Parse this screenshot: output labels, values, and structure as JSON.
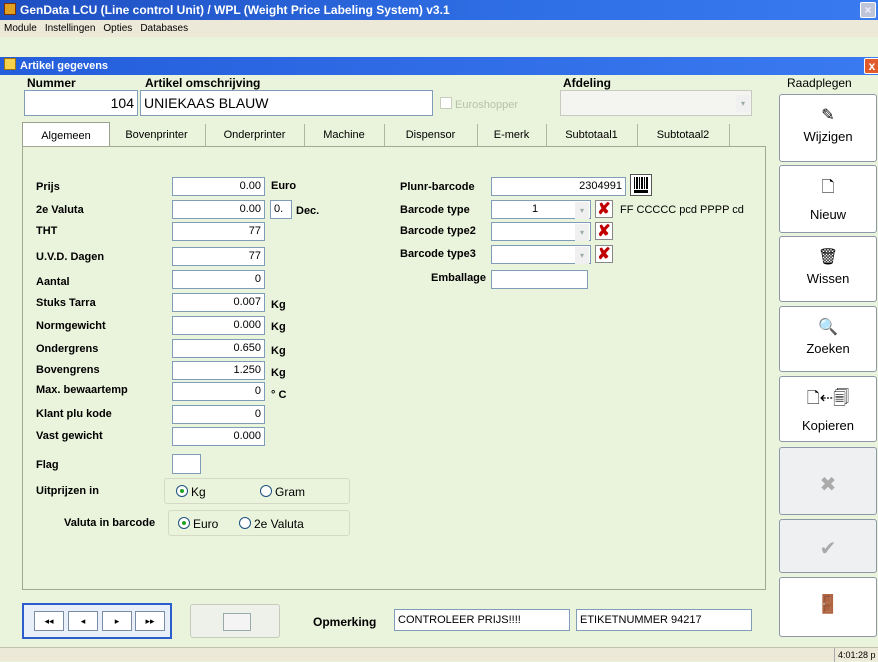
{
  "window": {
    "title": "GenData LCU (Line control Unit) / WPL (Weight Price Labeling System)  v3.1"
  },
  "menu": [
    "Module",
    "Instellingen",
    "Opties",
    "Databases"
  ],
  "subwindow": {
    "title": "Artikel gegevens",
    "close": "x"
  },
  "header": {
    "nummer_label": "Nummer",
    "nummer_value": "104",
    "omschrijving_label": "Artikel omschrijving",
    "omschrijving_value": "UNIEKAAS BLAUW",
    "euroshopper_label": "Euroshopper",
    "afdeling_label": "Afdeling",
    "afdeling_value": ""
  },
  "tabs": [
    "Algemeen",
    "Bovenprinter",
    "Onderprinter",
    "Machine",
    "Dispensor",
    "E-merk",
    "Subtotaal1",
    "Subtotaal2"
  ],
  "form": {
    "prijs": {
      "label": "Prijs",
      "value": "0.00",
      "unit": "Euro"
    },
    "valuta": {
      "label": "2e Valuta",
      "value": "0.00",
      "dec_value": "0.",
      "dec_label": "Dec."
    },
    "tht": {
      "label": "THT",
      "value": "77"
    },
    "uvd": {
      "label": "U.V.D. Dagen",
      "value": "77"
    },
    "aantal": {
      "label": "Aantal",
      "value": "0"
    },
    "tarra": {
      "label": "Stuks Tarra",
      "value": "0.007",
      "unit": "Kg"
    },
    "norm": {
      "label": "Normgewicht",
      "value": "0.000",
      "unit": "Kg"
    },
    "onder": {
      "label": "Ondergrens",
      "value": "0.650",
      "unit": "Kg"
    },
    "boven": {
      "label": "Bovengrens",
      "value": "1.250",
      "unit": "Kg"
    },
    "bewaar": {
      "label": "Max. bewaartemp",
      "value": "0",
      "unit": "° C"
    },
    "klantplu": {
      "label": "Klant plu kode",
      "value": "0"
    },
    "vast": {
      "label": "Vast gewicht",
      "value": "0.000"
    },
    "flag": {
      "label": "Flag",
      "value": ""
    },
    "uitprijzen": {
      "label": "Uitprijzen in",
      "opt1": "Kg",
      "opt2": "Gram"
    },
    "valutabarcode": {
      "label": "Valuta in barcode",
      "opt1": "Euro",
      "opt2": "2e Valuta"
    }
  },
  "barcode": {
    "plunr": {
      "label": "Plunr-barcode",
      "value": "2304991"
    },
    "type1": {
      "label": "Barcode type",
      "value": "1",
      "format": "FF CCCCC pcd PPPP cd"
    },
    "type2": {
      "label": "Barcode type2",
      "value": ""
    },
    "type3": {
      "label": "Barcode type3",
      "value": ""
    },
    "emballage": {
      "label": "Emballage",
      "value": ""
    }
  },
  "sidebar": {
    "title": "Raadplegen",
    "buttons": [
      "Wijzigen",
      "Nieuw",
      "Wissen",
      "Zoeken",
      "Kopieren"
    ]
  },
  "bottom": {
    "opmerking_label": "Opmerking",
    "opmerking1": "CONTROLEER PRIJS!!!!",
    "opmerking2": "ETIKETNUMMER 94217"
  },
  "status": {
    "time": "4:01:28 p"
  },
  "colors": {
    "background": "#eaf3db",
    "titlebar": "#2f6fe6",
    "delete_x": "#c00000"
  }
}
